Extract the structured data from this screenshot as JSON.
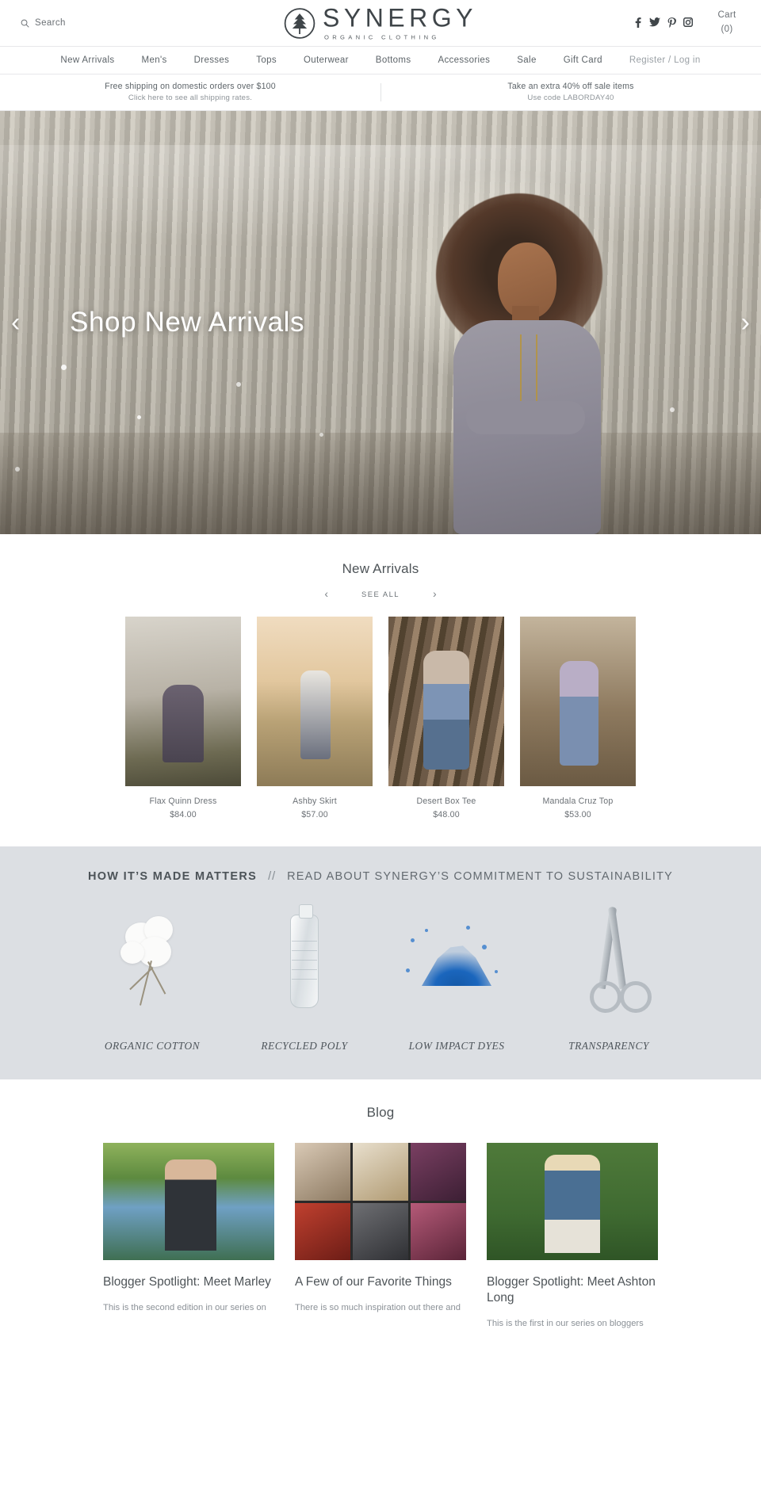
{
  "header": {
    "search_label": "Search",
    "search_icon": "search-icon",
    "logo_name": "SYNERGY",
    "logo_sub": "ORGANIC CLOTHING",
    "social": [
      {
        "name": "facebook-icon",
        "glyph": "f"
      },
      {
        "name": "twitter-icon",
        "glyph": "✈"
      },
      {
        "name": "pinterest-icon",
        "glyph": "Ѱ"
      },
      {
        "name": "instagram-icon",
        "glyph": "▣"
      }
    ],
    "cart_label": "Cart",
    "cart_count": "(0)"
  },
  "nav": {
    "items": [
      {
        "label": "New Arrivals",
        "muted": false
      },
      {
        "label": "Men's",
        "muted": false
      },
      {
        "label": "Dresses",
        "muted": false
      },
      {
        "label": "Tops",
        "muted": false
      },
      {
        "label": "Outerwear",
        "muted": false
      },
      {
        "label": "Bottoms",
        "muted": false
      },
      {
        "label": "Accessories",
        "muted": false
      },
      {
        "label": "Sale",
        "muted": false
      },
      {
        "label": "Gift Card",
        "muted": false
      },
      {
        "label": "Register / Log in",
        "muted": true
      }
    ]
  },
  "promo": {
    "left_line1": "Free shipping on domestic orders over $100",
    "left_line2": "Click here to see all shipping rates.",
    "right_line1": "Take an extra 40% off sale items",
    "right_line2": "Use code LABORDAY40"
  },
  "hero": {
    "caption": "Shop New Arrivals",
    "prev_arrow": "‹",
    "next_arrow": "›"
  },
  "new_arrivals": {
    "title": "New Arrivals",
    "prev_arrow": "‹",
    "next_arrow": "›",
    "see_all": "SEE ALL",
    "products": [
      {
        "name": "Flax Quinn Dress",
        "price": "$84.00"
      },
      {
        "name": "Ashby Skirt",
        "price": "$57.00"
      },
      {
        "name": "Desert Box Tee",
        "price": "$48.00"
      },
      {
        "name": "Mandala Cruz Top",
        "price": "$53.00"
      }
    ]
  },
  "sustainability": {
    "headline_strong": "HOW IT’S MADE MATTERS",
    "headline_slash": "//",
    "headline_light": "READ ABOUT SYNERGY’S COMMITMENT TO SUSTAINABILITY",
    "items": [
      {
        "label": "ORGANIC COTTON",
        "icon": "cotton-boll-icon"
      },
      {
        "label": "RECYCLED POLY",
        "icon": "plastic-bottle-icon"
      },
      {
        "label": "LOW IMPACT DYES",
        "icon": "dye-powder-icon"
      },
      {
        "label": "TRANSPARENCY",
        "icon": "scissors-icon"
      }
    ]
  },
  "blog": {
    "title": "Blog",
    "posts": [
      {
        "heading": "Blogger Spotlight: Meet Marley",
        "excerpt": "This is the second edition in our series on"
      },
      {
        "heading": "A Few of our Favorite Things",
        "excerpt": "There is so much inspiration out there and"
      },
      {
        "heading": "Blogger Spotlight: Meet Ashton Long",
        "excerpt": "This is the first in our series on bloggers"
      }
    ]
  },
  "colors": {
    "text_dark": "#4e5458",
    "text_muted": "#8b9197",
    "band_bg": "#dcdfe3",
    "border": "#e7e8ea"
  }
}
